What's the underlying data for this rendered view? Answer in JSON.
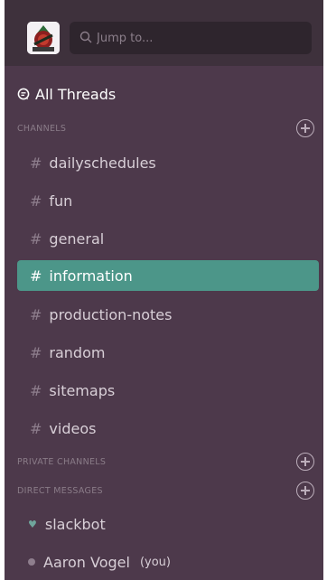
{
  "search": {
    "placeholder": "Jump to..."
  },
  "all_threads": {
    "label": "All Threads"
  },
  "channels_section": {
    "label": "CHANNELS"
  },
  "channels": [
    {
      "name": "dailyschedules"
    },
    {
      "name": "fun"
    },
    {
      "name": "general"
    },
    {
      "name": "information",
      "active": true
    },
    {
      "name": "production-notes"
    },
    {
      "name": "random"
    },
    {
      "name": "sitemaps"
    },
    {
      "name": "videos"
    }
  ],
  "private_section": {
    "label": "PRIVATE CHANNELS"
  },
  "dm_section": {
    "label": "DIRECT MESSAGES"
  },
  "direct_messages": [
    {
      "name": "slackbot",
      "icon": "heart-icon"
    },
    {
      "name": "Aaron Vogel",
      "suffix": "(you)",
      "icon": "presence-dot-icon"
    }
  ],
  "colors": {
    "sidebar": "#4d394b",
    "topbar": "#3e313c",
    "active": "#4c9689"
  }
}
